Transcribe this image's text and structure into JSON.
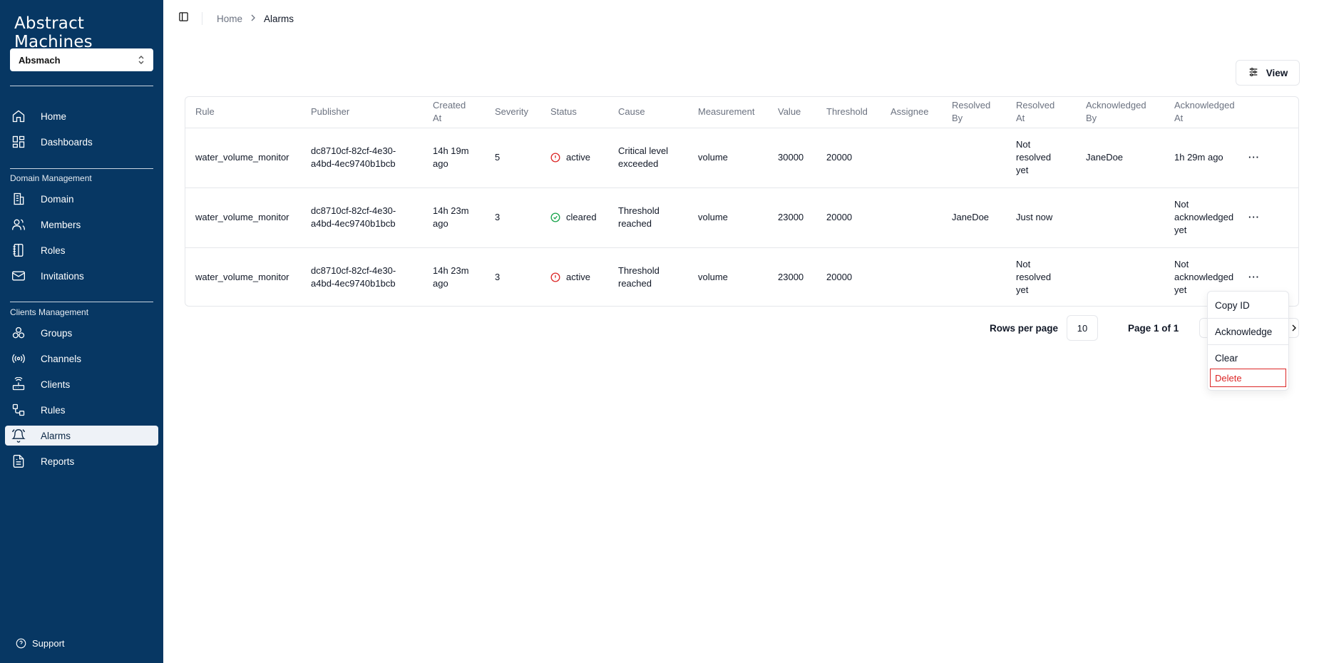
{
  "app": {
    "logo_text": "Abstract Machines",
    "domain_selector": "Absmach"
  },
  "sidebar": {
    "top_items": [
      {
        "label": "Home",
        "icon": "home-icon"
      },
      {
        "label": "Dashboards",
        "icon": "dashboard-icon"
      }
    ],
    "domain_section": "Domain Management",
    "domain_items": [
      {
        "label": "Domain",
        "icon": "building-icon"
      },
      {
        "label": "Members",
        "icon": "users-icon"
      },
      {
        "label": "Roles",
        "icon": "notebook-icon"
      },
      {
        "label": "Invitations",
        "icon": "mail-icon"
      }
    ],
    "clients_section": "Clients Management",
    "clients_items": [
      {
        "label": "Groups",
        "icon": "groups-icon"
      },
      {
        "label": "Channels",
        "icon": "radio-icon"
      },
      {
        "label": "Clients",
        "icon": "router-icon"
      },
      {
        "label": "Rules",
        "icon": "workflow-icon"
      },
      {
        "label": "Alarms",
        "icon": "bell-icon",
        "active": true
      },
      {
        "label": "Reports",
        "icon": "file-text-icon"
      }
    ],
    "support_label": "Support"
  },
  "breadcrumb": {
    "home": "Home",
    "current": "Alarms"
  },
  "toolbar": {
    "view_label": "View"
  },
  "table": {
    "headers": [
      [
        "Rule"
      ],
      [
        "Publisher"
      ],
      [
        "Created",
        "At"
      ],
      [
        "Severity"
      ],
      [
        "Status"
      ],
      [
        "Cause"
      ],
      [
        "Measurement"
      ],
      [
        "Value"
      ],
      [
        "Threshold"
      ],
      [
        "Assignee"
      ],
      [
        "Resolved",
        "By"
      ],
      [
        "Resolved",
        "At"
      ],
      [
        "Acknowledged",
        "By"
      ],
      [
        "Acknowledged",
        "At"
      ]
    ],
    "rows": [
      {
        "rule": "water_volume_monitor",
        "publisher": [
          "dc8710cf-82cf-4e30-",
          "a4bd-4ec9740b1bcb"
        ],
        "created_at": [
          "14h 19m",
          "ago"
        ],
        "severity": "5",
        "status": "active",
        "cause": [
          "Critical level",
          "exceeded"
        ],
        "measurement": "volume",
        "value": "30000",
        "threshold": "20000",
        "assignee": "",
        "resolved_by": "",
        "resolved_at": [
          "Not",
          "resolved",
          "yet"
        ],
        "acknowledged_by": "JaneDoe",
        "acknowledged_at": [
          "1h 29m ago"
        ]
      },
      {
        "rule": "water_volume_monitor",
        "publisher": [
          "dc8710cf-82cf-4e30-",
          "a4bd-4ec9740b1bcb"
        ],
        "created_at": [
          "14h 23m",
          "ago"
        ],
        "severity": "3",
        "status": "cleared",
        "cause": [
          "Threshold",
          "reached"
        ],
        "measurement": "volume",
        "value": "23000",
        "threshold": "20000",
        "assignee": "",
        "resolved_by": "JaneDoe",
        "resolved_at": [
          "Just now"
        ],
        "acknowledged_by": "",
        "acknowledged_at": [
          "Not",
          "acknowledged",
          "yet"
        ]
      },
      {
        "rule": "water_volume_monitor",
        "publisher": [
          "dc8710cf-82cf-4e30-",
          "a4bd-4ec9740b1bcb"
        ],
        "created_at": [
          "14h 23m",
          "ago"
        ],
        "severity": "3",
        "status": "active",
        "cause": [
          "Threshold",
          "reached"
        ],
        "measurement": "volume",
        "value": "23000",
        "threshold": "20000",
        "assignee": "",
        "resolved_by": "",
        "resolved_at": [
          "Not",
          "resolved",
          "yet"
        ],
        "acknowledged_by": "",
        "acknowledged_at": [
          "Not",
          "acknowledged",
          "yet"
        ]
      }
    ],
    "row_menu_glyph": "···"
  },
  "pagination": {
    "rows_per_page_label": "Rows per page",
    "rows_per_page": "10",
    "page_label": "Page 1 of 1"
  },
  "context_menu": {
    "items": [
      "Copy ID",
      "Acknowledge",
      "Clear"
    ],
    "danger_item": "Delete"
  },
  "colors": {
    "sidebar_bg": "#073763",
    "active_status": "#dc2626",
    "cleared_status": "#16a34a",
    "danger": "#dc2626"
  }
}
